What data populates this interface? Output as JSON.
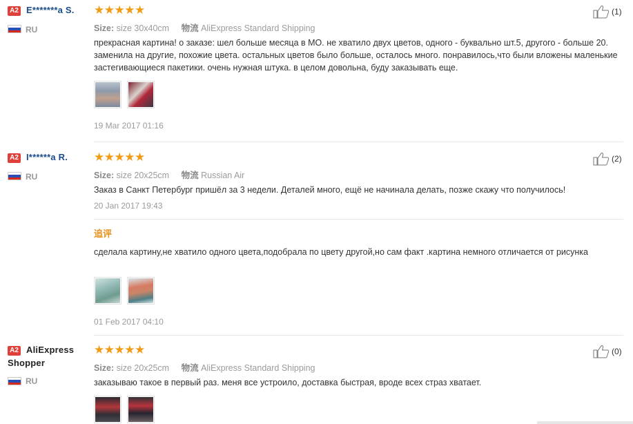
{
  "reviews": [
    {
      "badge": "A2",
      "user": "E*******a S.",
      "country": "RU",
      "stars": "★★★★★",
      "size_label": "Size:",
      "size_value": "size 30x40cm",
      "ship_label": "物流",
      "ship_value": "AliExpress Standard Shipping",
      "text": "прекрасная картина! о заказе: шел больше месяца в МО. не хватило двух цветов, одного - буквально шт.5, другого - больше 20. заменила на другие, похожие цвета. остальных цветов было больше, осталось много. понравилось,что были вложены маленькие застегивающиеся пакетики. очень нужная штука. в целом довольна, буду заказывать еще.",
      "date": "19 Mar 2017 01:16",
      "likes": "(1)"
    },
    {
      "badge": "A2",
      "user": "I******a R.",
      "country": "RU",
      "stars": "★★★★★",
      "size_label": "Size:",
      "size_value": "size 20x25cm",
      "ship_label": "物流",
      "ship_value": "Russian Air",
      "text": "Заказ в Санкт Петербург пришёл за 3 недели. Деталей много, ещё не начинала делать, позже скажу что получилось!",
      "date": "20 Jan 2017 19:43",
      "additional_label": "追评",
      "additional_text": "сделала картину,не хватило одного цвета,подобрала по цвету другой,но сам факт .картина немного отличается от рисунка",
      "additional_date": "01 Feb 2017 04:10",
      "likes": "(2)"
    },
    {
      "badge": "A2",
      "user_line1": "AliExpress",
      "user_line2": "Shopper",
      "country": "RU",
      "stars": "★★★★★",
      "size_label": "Size:",
      "size_value": "size 20x25cm",
      "ship_label": "物流",
      "ship_value": "AliExpress Standard Shipping",
      "text": "заказываю такое в первый раз. меня все устроило, доставка быстрая, вроде всех страз хватает.",
      "likes": "(0)"
    }
  ],
  "colors": {
    "star": "#f29b14",
    "user_link": "#1a4c8a",
    "badge": "#e0403a",
    "additional_label": "#e8901a"
  },
  "icons": {
    "like": "thumbs-up-icon",
    "flag": "russia-flag-icon"
  }
}
